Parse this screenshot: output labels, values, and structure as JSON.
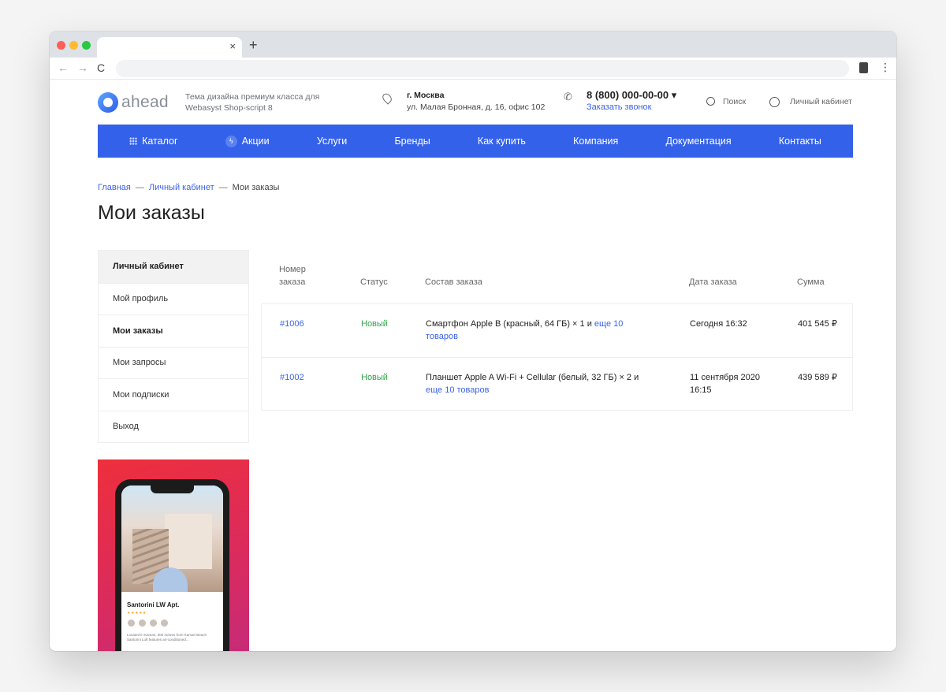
{
  "browser": {
    "tab_close": "×",
    "new_tab": "+",
    "back": "←",
    "forward": "→",
    "reload": "C",
    "menu": "⋮"
  },
  "header": {
    "logo_text": "ahead",
    "tagline": "Тема дизайна премиум класса для Webasyst Shop-script 8",
    "city": "г. Москва",
    "address": "ул. Малая Бронная, д. 16, офис 102",
    "phone": "8 (800) 000-00-00",
    "phone_caret": "▾",
    "callback": "Заказать звонок",
    "search_label": "Поиск",
    "account_label": "Личный кабинет"
  },
  "nav": {
    "items": [
      {
        "label": "Каталог"
      },
      {
        "label": "Акции"
      },
      {
        "label": "Услуги"
      },
      {
        "label": "Бренды"
      },
      {
        "label": "Как купить"
      },
      {
        "label": "Компания"
      },
      {
        "label": "Документация"
      },
      {
        "label": "Контакты"
      }
    ]
  },
  "breadcrumb": {
    "items": [
      "Главная",
      "Личный кабинет",
      "Мои заказы"
    ],
    "separator": "—"
  },
  "page_title": "Мои заказы",
  "sidebar": {
    "items": [
      "Личный кабинет",
      "Мой профиль",
      "Мои заказы",
      "Мои запросы",
      "Мои подписки",
      "Выход"
    ]
  },
  "orders": {
    "headers": {
      "number": "Номер заказа",
      "status": "Статус",
      "items": "Состав заказа",
      "date": "Дата заказа",
      "sum": "Сумма"
    },
    "rows": [
      {
        "number": "#1006",
        "status": "Новый",
        "items_text": "Смартфон Apple B (красный, 64 ГБ) × 1 и",
        "items_more": "еще 10 товаров",
        "date": "Сегодня 16:32",
        "sum": "401 545 ₽"
      },
      {
        "number": "#1002",
        "status": "Новый",
        "items_text": "Планшет Apple A Wi-Fi + Cellular (белый, 32 ГБ) × 2 и",
        "items_more": "еще 10 товаров",
        "date": "11 сентября 2020 16:15",
        "sum": "439 589 ₽"
      }
    ]
  },
  "promo": {
    "app_title": "Santorini LW Apt.",
    "stars": "★★★★★",
    "app_desc": "Located in Kamari, 300 metres from Kamari Beach Santorini Loft features air-conditioned..."
  },
  "colors": {
    "accent": "#3461ea",
    "link": "#3b63e8",
    "status_new": "#32a04a"
  }
}
